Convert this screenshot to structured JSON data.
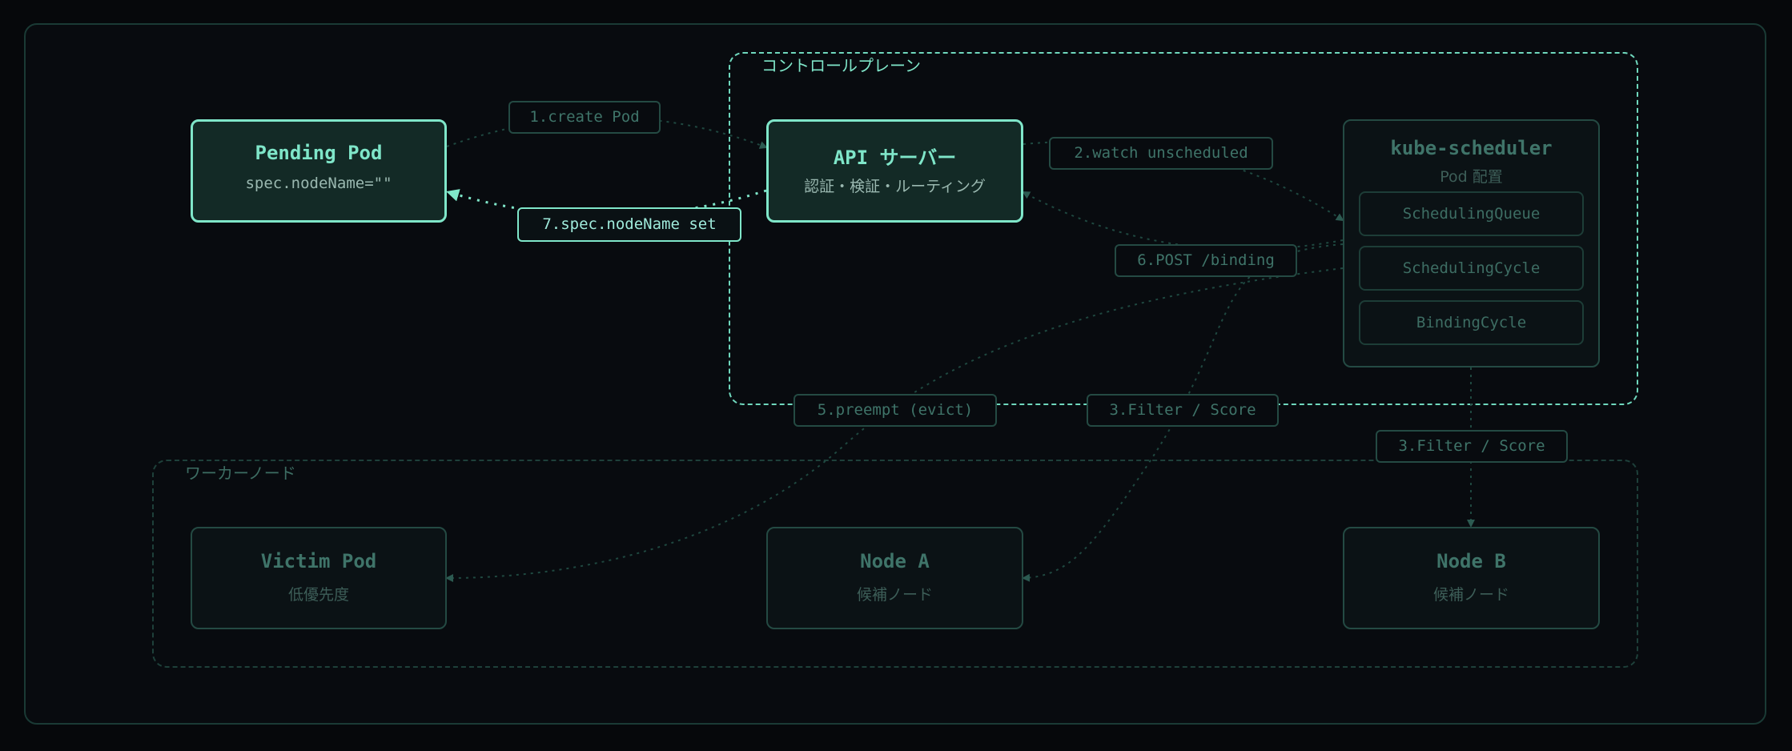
{
  "groups": {
    "control_plane": "コントロールプレーン",
    "worker_nodes": "ワーカーノード"
  },
  "nodes": {
    "pending_pod": {
      "title": "Pending Pod",
      "subtitle": "spec.nodeName=\"\""
    },
    "api_server": {
      "title": "API サーバー",
      "subtitle": "認証・検証・ルーティング"
    },
    "scheduler": {
      "title": "kube-scheduler",
      "subtitle": "Pod 配置",
      "components": [
        "SchedulingQueue",
        "SchedulingCycle",
        "BindingCycle"
      ]
    },
    "victim_pod": {
      "title": "Victim Pod",
      "subtitle": "低優先度"
    },
    "node_a": {
      "title": "Node A",
      "subtitle": "候補ノード"
    },
    "node_b": {
      "title": "Node B",
      "subtitle": "候補ノード"
    }
  },
  "edges": {
    "create_pod": "1.create Pod",
    "watch_unscheduled": "2.watch unscheduled",
    "filter_score_a": "3.Filter / Score",
    "filter_score_b": "3.Filter / Score",
    "preempt": "5.preempt (evict)",
    "post_binding": "6.POST /binding",
    "node_name_set": "7.spec.nodeName set"
  },
  "colors": {
    "accent": "#7fe6c9",
    "dim": "#244a43",
    "background": "#06080b"
  }
}
